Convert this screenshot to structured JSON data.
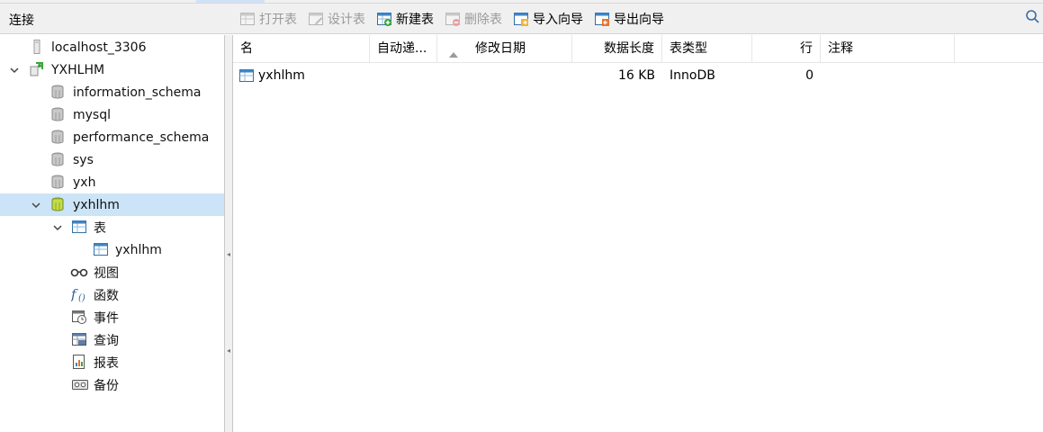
{
  "header": {
    "connection_title": "连接"
  },
  "toolbar": {
    "buttons": [
      {
        "label": "打开表",
        "icon": "open-table-icon",
        "enabled": false
      },
      {
        "label": "设计表",
        "icon": "design-table-icon",
        "enabled": false
      },
      {
        "label": "新建表",
        "icon": "new-table-icon",
        "enabled": true
      },
      {
        "label": "删除表",
        "icon": "delete-table-icon",
        "enabled": false
      },
      {
        "label": "导入向导",
        "icon": "import-wizard-icon",
        "enabled": true
      },
      {
        "label": "导出向导",
        "icon": "export-wizard-icon",
        "enabled": true
      }
    ]
  },
  "sidebar": {
    "connection_1": "localhost_3306",
    "connection_2": "YXHLHM",
    "databases": [
      "information_schema",
      "mysql",
      "performance_schema",
      "sys",
      "yxh",
      "yxhlhm"
    ],
    "tables_label": "表",
    "table_item": "yxhlhm",
    "views_label": "视图",
    "functions_label": "函数",
    "events_label": "事件",
    "queries_label": "查询",
    "reports_label": "报表",
    "backups_label": "备份"
  },
  "grid": {
    "columns": [
      "名",
      "自动递...",
      "修改日期",
      "数据长度",
      "表类型",
      "行",
      "注释"
    ],
    "rows": [
      {
        "name": "yxhlhm",
        "auto_inc": "",
        "modified": "",
        "data_length": "16 KB",
        "engine": "InnoDB",
        "rows": "0",
        "comment": ""
      }
    ]
  },
  "colors": {
    "selection": "#cce4f7",
    "toolbar_bg": "#f0f0f0",
    "disabled_text": "#9a9a9a"
  }
}
